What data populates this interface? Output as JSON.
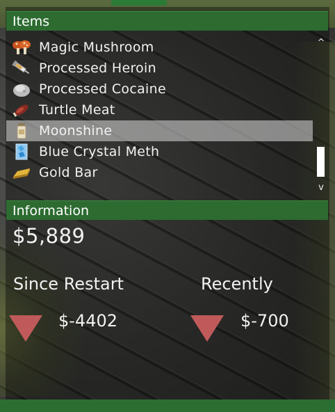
{
  "colors": {
    "header_green": "#2d6b31",
    "selected_row": "#c8c8c8",
    "down_arrow": "#c05a5a",
    "text": "#f2f2f2"
  },
  "items_panel": {
    "title": "Items",
    "items": [
      {
        "label": "Magic Mushroom",
        "icon": "mushroom-icon"
      },
      {
        "label": "Processed Heroin",
        "icon": "syringe-icon"
      },
      {
        "label": "Processed Cocaine",
        "icon": "powder-pile-icon"
      },
      {
        "label": "Turtle Meat",
        "icon": "meat-icon"
      },
      {
        "label": "Moonshine",
        "icon": "jar-icon",
        "selected": true
      },
      {
        "label": "Blue Crystal Meth",
        "icon": "blue-crystal-icon"
      },
      {
        "label": "Gold Bar",
        "icon": "gold-bar-icon"
      }
    ],
    "scroll_up": "^",
    "scroll_down": "v"
  },
  "information_panel": {
    "title": "Information",
    "total": "$5,889",
    "since_restart": {
      "label": "Since Restart",
      "value": "$-4402",
      "trend": "down"
    },
    "recently": {
      "label": "Recently",
      "value": "$-700",
      "trend": "down"
    }
  }
}
